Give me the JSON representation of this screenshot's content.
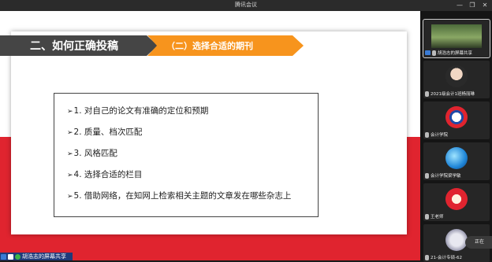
{
  "window": {
    "title": "腾讯会议",
    "buttons": {
      "minimize": "—",
      "restore": "❐",
      "close": "✕"
    }
  },
  "slide": {
    "section_title": "二、如何正确投稿",
    "subsection_title": "（二）选择合适的期刊",
    "items": [
      "1. 对自己的论文有准确的定位和预期",
      "2. 质量、档次匹配",
      "3. 风格匹配",
      "4. 选择合适的栏目",
      "5. 借助网络，在知网上检索相关主题的文章发在哪些杂志上"
    ],
    "bullet": "➢"
  },
  "share_status": {
    "label": "胡浩志的屏幕共享"
  },
  "participants": [
    {
      "name": "胡浩志的屏幕共享",
      "avatar": "landscape-thumbnail",
      "active": true
    },
    {
      "name": "2021级会计1班杨丽琳",
      "avatar": "person-photo"
    },
    {
      "name": "会计学院",
      "avatar": "school-logo"
    },
    {
      "name": "会计学院梁学敏",
      "avatar": "globe-logo"
    },
    {
      "name": "王老师",
      "avatar": "cartoon-avatar"
    },
    {
      "name": "21-会计专硕-62",
      "avatar": "cat-avatar"
    }
  ],
  "sharing_pill": {
    "label": "正在"
  },
  "colors": {
    "accent_orange": "#f7941d",
    "header_dark": "#454545",
    "band_red": "#e0242f"
  }
}
